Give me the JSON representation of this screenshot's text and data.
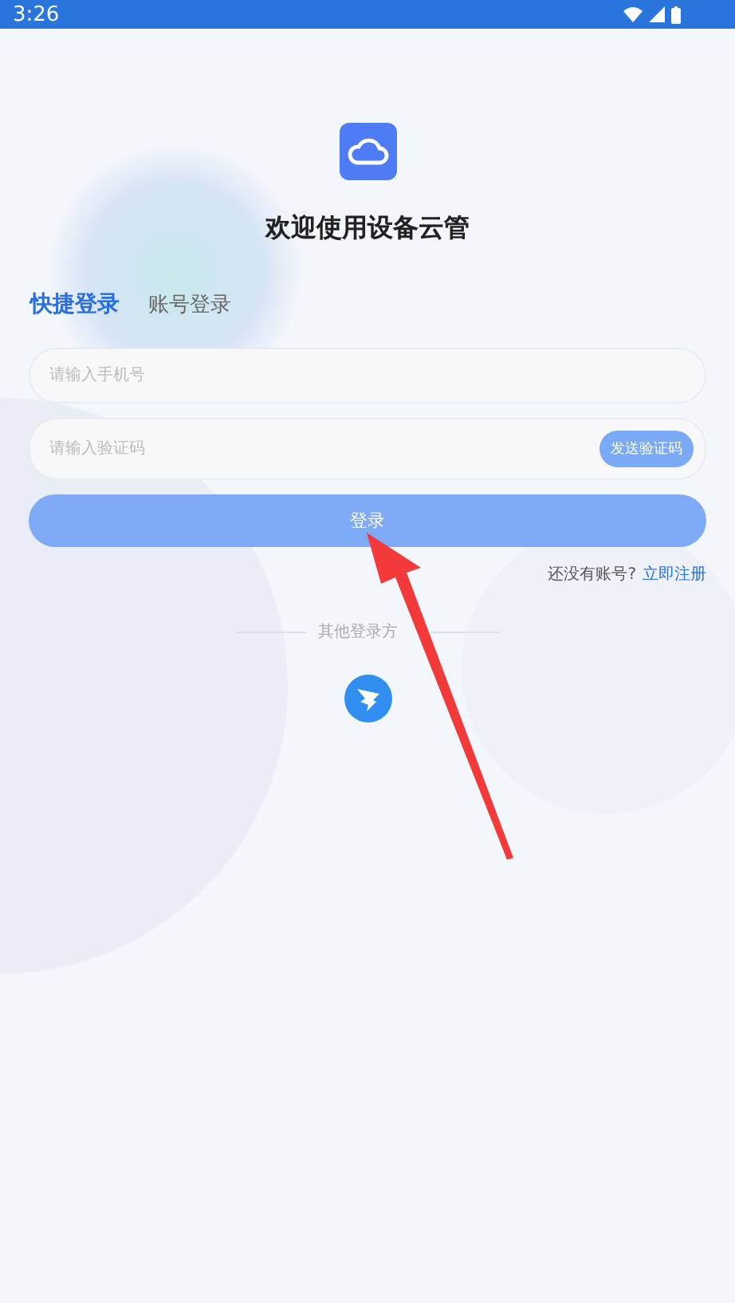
{
  "status_bar": {
    "time": "3:26"
  },
  "title": "欢迎使用设备云管",
  "tabs": [
    {
      "label": "快捷登录",
      "selected": true
    },
    {
      "label": "账号登录",
      "selected": false
    }
  ],
  "phone_field": {
    "placeholder": "请输入手机号"
  },
  "code_field": {
    "placeholder": "请输入验证码",
    "send_button": "发送验证码"
  },
  "login_button": "登录",
  "register": {
    "prompt": "还没有账号?",
    "link": "立即注册"
  },
  "other_login": "其他登录方"
}
